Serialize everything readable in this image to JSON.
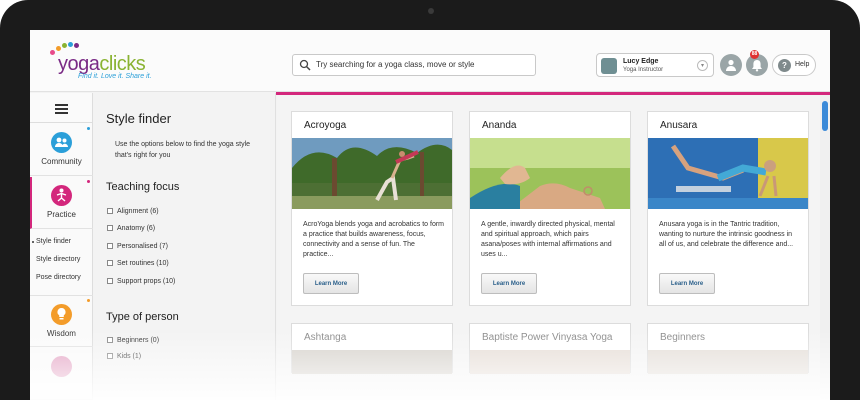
{
  "brand": {
    "logo_main": "yoga",
    "logo_accent": "clicks",
    "tagline": "Find it. Love it. Share it."
  },
  "search": {
    "placeholder": "Try searching for a yoga class, move or style"
  },
  "user": {
    "name": "Lucy Edge",
    "role": "Yoga Instructor"
  },
  "header": {
    "notification_count": "88",
    "help_label": "Help"
  },
  "nav": {
    "items": [
      {
        "label": "Community",
        "color": "#2b9fd9",
        "icon": "people-icon"
      },
      {
        "label": "Practice",
        "color": "#d3277c",
        "icon": "yoga-pose-icon"
      },
      {
        "label": "Wisdom",
        "color": "#f39c2a",
        "icon": "lightbulb-icon"
      }
    ],
    "subitems": [
      "Style finder",
      "Style directory",
      "Pose directory"
    ]
  },
  "filters": {
    "title": "Style finder",
    "intro": "Use the options below to find the yoga style that's right for you",
    "teaching_heading": "Teaching focus",
    "teaching_options": [
      "Alignment (6)",
      "Anatomy (6)",
      "Personalised (7)",
      "Set routines (10)",
      "Support props (10)"
    ],
    "person_heading": "Type of person",
    "person_options": [
      "Beginners (0)",
      "Kids (1)"
    ]
  },
  "styles": [
    {
      "title": "Acroyoga",
      "desc": "AcroYoga blends yoga and acrobatics to form a practice that builds awareness, focus, connectivity and a sense of fun. The practice...",
      "button": "Learn More"
    },
    {
      "title": "Ananda",
      "desc": "A gentle, inwardly directed physical, mental and spiritual approach, which pairs asana/poses with internal affirmations and uses u...",
      "button": "Learn More"
    },
    {
      "title": "Anusara",
      "desc": "Anusara yoga is in the Tantric tradition, wanting to nurture the intrinsic goodness in all of us, and celebrate the difference and...",
      "button": "Learn More"
    },
    {
      "title": "Ashtanga"
    },
    {
      "title": "Baptiste Power Vinyasa Yoga"
    },
    {
      "title": "Beginners"
    }
  ],
  "colors": {
    "accent": "#d3277c",
    "community": "#2b9fd9",
    "practice": "#d3277c",
    "wisdom": "#f39c2a"
  }
}
